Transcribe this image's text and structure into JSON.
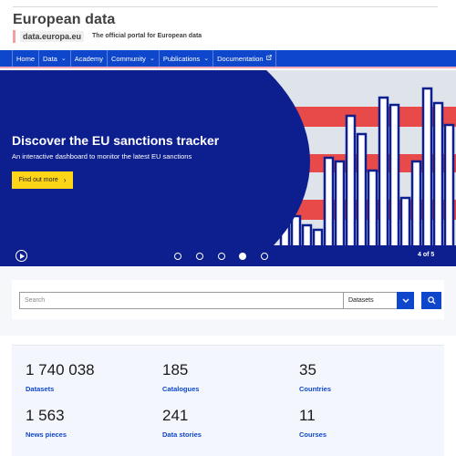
{
  "header": {
    "site_title": "European data",
    "domain": "data.europa.eu",
    "tagline": "The official portal for European data"
  },
  "nav": {
    "items": [
      {
        "label": "Home",
        "has_dropdown": false
      },
      {
        "label": "Data",
        "has_dropdown": true
      },
      {
        "label": "Academy",
        "has_dropdown": false
      },
      {
        "label": "Community",
        "has_dropdown": true
      },
      {
        "label": "Publications",
        "has_dropdown": true
      },
      {
        "label": "Documentation",
        "has_dropdown": false,
        "external": true
      }
    ]
  },
  "hero": {
    "title": "Discover the EU sanctions tracker",
    "subtitle": "An interactive dashboard to monitor the latest EU sanctions",
    "button_label": "Find out more",
    "slide_counter": "4 of 5",
    "total_slides": 5,
    "active_slide": 4
  },
  "search": {
    "placeholder": "Search",
    "selected_type": "Datasets"
  },
  "stats": [
    {
      "value": "1 740 038",
      "label": "Datasets"
    },
    {
      "value": "185",
      "label": "Catalogues"
    },
    {
      "value": "35",
      "label": "Countries"
    },
    {
      "value": "1 563",
      "label": "News pieces"
    },
    {
      "value": "241",
      "label": "Data stories"
    },
    {
      "value": "11",
      "label": "Courses"
    }
  ],
  "colors": {
    "eu_blue": "#0e47cb",
    "hero_navy": "#0d1f8f",
    "accent_yellow": "#ffd617",
    "accent_red": "#e84a4a"
  },
  "icons": {
    "external_link": "external-link-icon",
    "chevron_down": "chevron-down-icon",
    "play": "play-icon",
    "search": "search-icon"
  }
}
